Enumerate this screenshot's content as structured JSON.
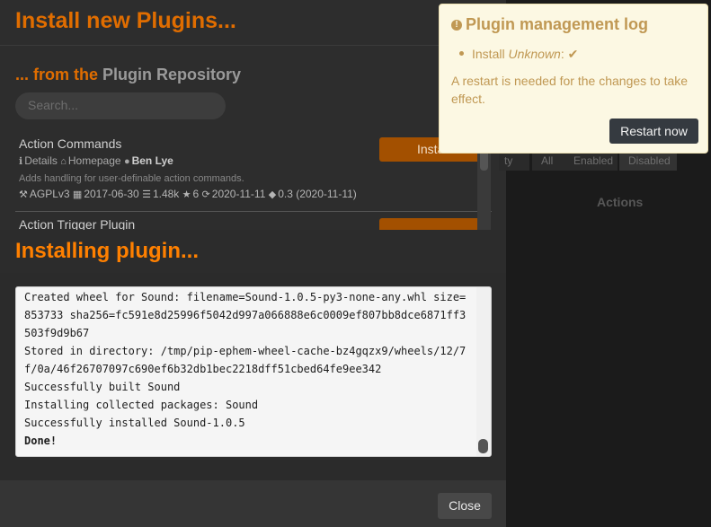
{
  "background": {
    "title": "Install new Plugins...",
    "subtitle_prefix": "... from the",
    "subtitle_link": "Plugin Repository",
    "search_placeholder": "Search...",
    "plugins": [
      {
        "name": "Action Commands",
        "details_label": "Details",
        "homepage_label": "Homepage",
        "author": "Ben Lye",
        "description": "Adds handling for user-definable action commands.",
        "license": "AGPLv3",
        "date": "2017-06-30",
        "downloads": "1.48k",
        "stars": "6",
        "updated": "2020-11-11",
        "version": "0.3 (2020-11-11)",
        "install_label": "Install"
      },
      {
        "name": "Action Trigger Plugin",
        "install_label": ""
      }
    ],
    "tabs": [
      "ty",
      "All",
      "Enabled",
      "Disabled"
    ],
    "actions_label": "Actions"
  },
  "modal": {
    "title": "Installing plugin...",
    "log_lines": [
      "Created wheel for Sound: filename=Sound-1.0.5-py3-none-any.whl size=",
      "853733 sha256=fc591e8d25996f5042d997a066888e6c0009ef807bb8dce6871ff3",
      "503f9d9b67",
      "Stored in directory: /tmp/pip-ephem-wheel-cache-bz4gqzx9/wheels/12/7",
      "f/0a/46f26707097c690ef6b32db1bec2218dff51cbed64fe9ee342",
      "Successfully built Sound",
      "Installing collected packages: Sound",
      "Successfully installed Sound-1.0.5"
    ],
    "log_done": "Done!",
    "close_label": "Close"
  },
  "notification": {
    "title": "Plugin management log",
    "item_prefix": "Install",
    "item_name": "Unknown",
    "item_suffix": ":",
    "message": "A restart is needed for the changes to take effect.",
    "restart_label": "Restart now"
  },
  "colors": {
    "accent_orange": "#ff8000",
    "warning_text": "#c09853",
    "warning_bg": "#fcf8e3"
  }
}
